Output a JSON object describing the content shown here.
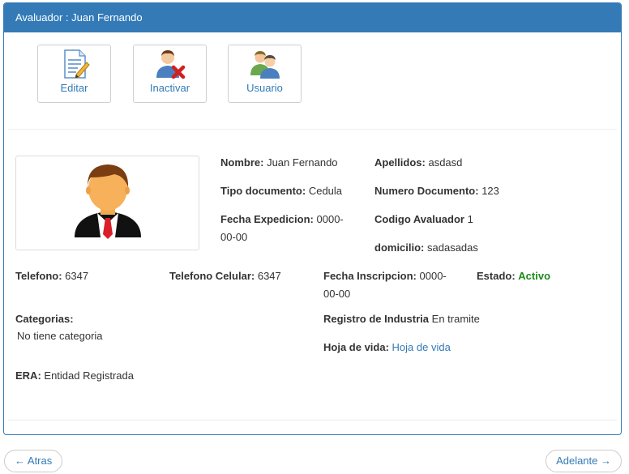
{
  "panel": {
    "title": "Avaluador : Juan Fernando"
  },
  "toolbar": {
    "edit_label": "Editar",
    "inactivate_label": "Inactivar",
    "user_label": "Usuario"
  },
  "profile": {
    "nombre_label": "Nombre:",
    "nombre": "Juan Fernando",
    "apellidos_label": "Apellidos:",
    "apellidos": "asdasd",
    "tipo_doc_label": "Tipo documento:",
    "tipo_doc": "Cedula",
    "num_doc_label": "Numero Documento:",
    "num_doc": "123",
    "fecha_exp_label": "Fecha Expedicion:",
    "fecha_exp_1": "0000-",
    "fecha_exp_2": "00-00",
    "codigo_label": "Codigo Avaluador",
    "codigo": "1",
    "domicilio_label": "domicilio:",
    "domicilio": "sadasadas",
    "telefono_label": "Telefono:",
    "telefono": "6347",
    "celular_label": "Telefono Celular:",
    "celular": "6347",
    "fecha_ins_label": "Fecha Inscripcion:",
    "fecha_ins_1": "0000-",
    "fecha_ins_2": "00-00",
    "estado_label": "Estado:",
    "estado": "Activo",
    "categorias_label": "Categorias:",
    "categorias": "No tiene categoria",
    "registro_label": "Registro de Industria",
    "registro": "En tramite",
    "hoja_label": "Hoja de vida:",
    "hoja": "Hoja de vida",
    "era_label": "ERA:",
    "era": "Entidad Registrada"
  },
  "pager": {
    "prev": "← Atras",
    "next": "Adelante →"
  },
  "colors": {
    "primary": "#337ab7",
    "active": "#1b8a1b"
  }
}
